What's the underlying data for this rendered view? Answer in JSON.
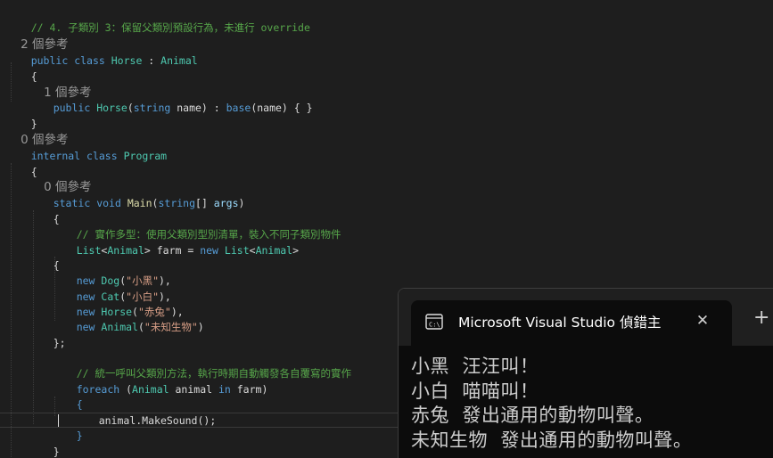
{
  "editor": {
    "codelens": {
      "horse_refs": "2 個參考",
      "horse_ctor_refs": "1 個參考",
      "program_refs": "0 個參考",
      "main_refs": "0 個參考"
    },
    "lines": {
      "comment_subclass3": "// 4. 子類別 3：保留父類別預設行為，未進行 override",
      "horse_decl": [
        "public",
        " ",
        "class",
        " ",
        "Horse",
        " : ",
        "Animal"
      ],
      "open_brace": "{",
      "close_brace": "}",
      "horse_ctor": [
        "public",
        " ",
        "Horse",
        "(",
        "string",
        " name) : ",
        "base",
        "(name) { }"
      ],
      "program_decl": [
        "internal",
        " ",
        "class",
        " ",
        "Program"
      ],
      "main_decl": [
        "static",
        " ",
        "void",
        " ",
        "Main",
        "(",
        "string",
        "[] ",
        "args",
        ")"
      ],
      "comment_polymorphism": "// 實作多型：使用父類別型別清單，裝入不同子類別物件",
      "list_decl": [
        "List",
        "<",
        "Animal",
        "> farm = ",
        "new",
        " ",
        "List",
        "<",
        "Animal",
        ">"
      ],
      "new_dog": [
        "new",
        " ",
        "Dog",
        "(",
        "\"小黑\"",
        "),"
      ],
      "new_cat": [
        "new",
        " ",
        "Cat",
        "(",
        "\"小白\"",
        "),"
      ],
      "new_horse": [
        "new",
        " ",
        "Horse",
        "(",
        "\"赤兔\"",
        "),"
      ],
      "new_animal": [
        "new",
        " ",
        "Animal",
        "(",
        "\"未知生物\"",
        ")"
      ],
      "close_init": "};",
      "comment_unified": "// 統一呼叫父類別方法，執行時期自動觸發各自覆寫的實作",
      "foreach_line": [
        "foreach",
        " (",
        "Animal",
        " animal ",
        "in",
        " farm)"
      ],
      "make_sound": "animal.MakeSound();"
    }
  },
  "terminal": {
    "tab_title": "Microsoft Visual Studio 偵錯主",
    "close_glyph": "✕",
    "new_tab_glyph": "+",
    "output": [
      "小黑  汪汪叫！",
      "小白  喵喵叫！",
      "赤兔  發出通用的動物叫聲。",
      "未知生物  發出通用的動物叫聲。"
    ]
  }
}
